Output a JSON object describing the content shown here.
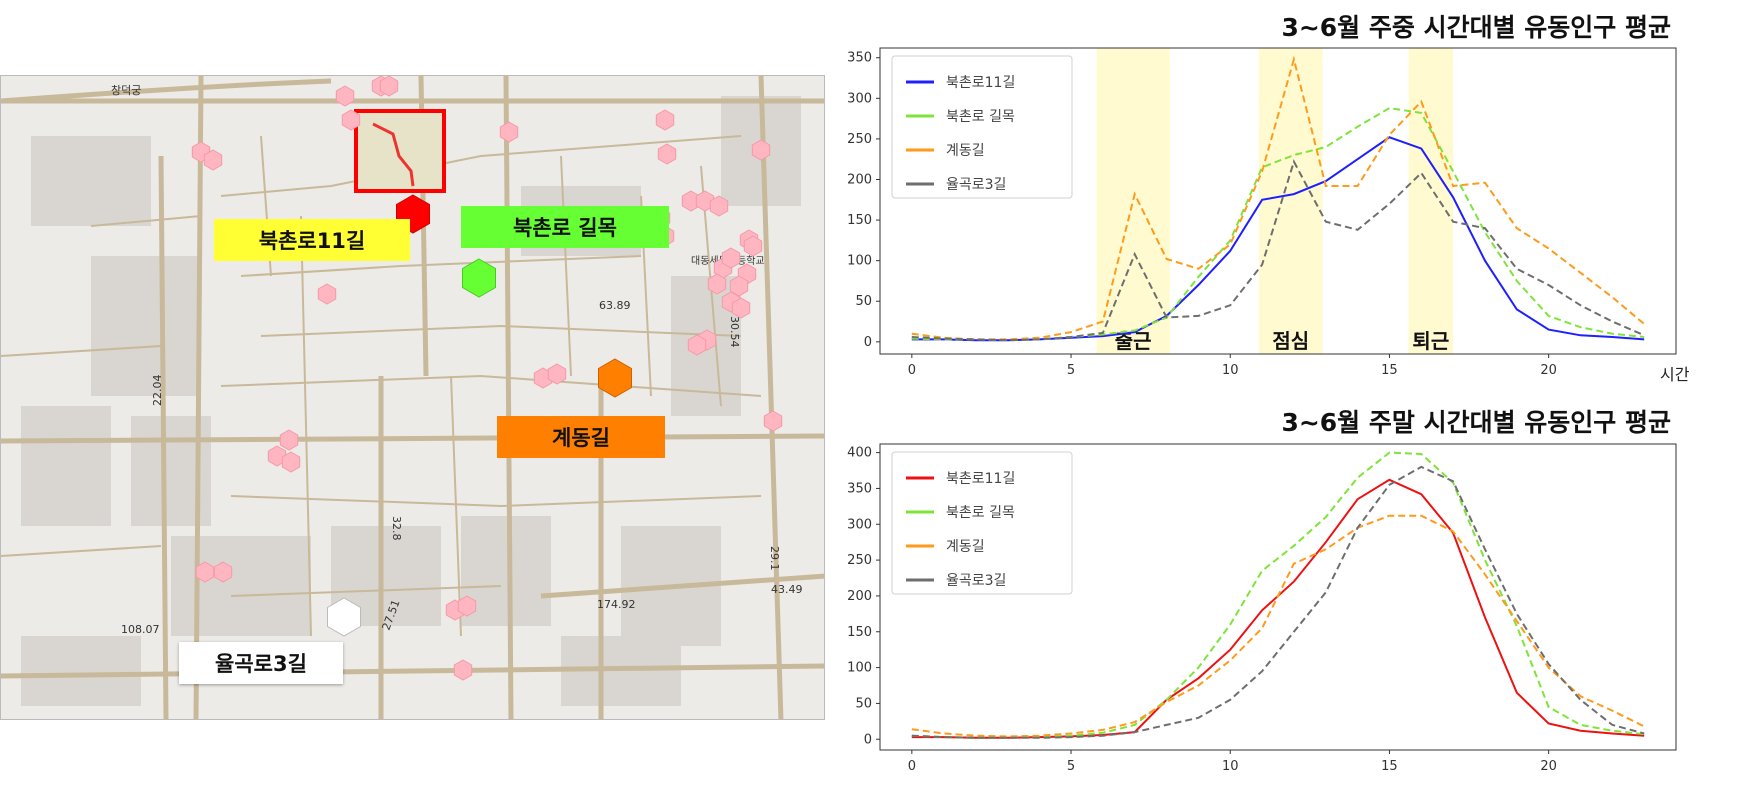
{
  "map": {
    "labels": {
      "bukchon11": "북촌로11길",
      "bukchon_alley": "북촌로 길목",
      "gyedong": "계동길",
      "yulgok3": "율곡로3길"
    },
    "colors": {
      "bukchon11": "#ffff33",
      "bukchon_alley": "#66ff33",
      "gyedong": "#ff8000",
      "yulgok3": "#ffffff",
      "bukchon11_marker": "#ff0000",
      "hex_other": "#ffb6c1",
      "highlight_box": "#ff0000"
    },
    "map_text": [
      "창덕궁",
      "대동세무고등학교",
      "63.89",
      "30.54",
      "32.8",
      "27.51",
      "22.04",
      "108.07",
      "174.92",
      "43.49",
      "29.1"
    ]
  },
  "charts": {
    "weekday": {
      "title": "3~6월 주중 시간대별 유동인구 평균",
      "x_unit": "시간",
      "bands": [
        {
          "label": "출근",
          "from": 5.8,
          "to": 8.1
        },
        {
          "label": "점심",
          "from": 10.9,
          "to": 12.9
        },
        {
          "label": "퇴근",
          "from": 15.6,
          "to": 17.0
        }
      ]
    },
    "weekend": {
      "title": "3~6월 주말 시간대별 유동인구 평균"
    }
  },
  "chart_data": [
    {
      "type": "line",
      "title": "3~6월 주중 시간대별 유동인구 평균",
      "xlabel": "시간",
      "ylabel": "",
      "xlim": [
        -1,
        24
      ],
      "ylim": [
        -15,
        362
      ],
      "x_ticks": [
        0,
        5,
        10,
        15,
        20
      ],
      "y_ticks": [
        0,
        50,
        100,
        150,
        200,
        250,
        300,
        350
      ],
      "legend": "top-left",
      "grid": false,
      "x": [
        0,
        1,
        2,
        3,
        4,
        5,
        6,
        7,
        8,
        9,
        10,
        11,
        12,
        13,
        14,
        15,
        16,
        17,
        18,
        19,
        20,
        21,
        22,
        23
      ],
      "series": [
        {
          "name": "북촌로11길",
          "color": "#1f1fff",
          "dash": "solid",
          "values": [
            3,
            3,
            2,
            2,
            3,
            5,
            7,
            12,
            32,
            70,
            112,
            175,
            182,
            198,
            225,
            252,
            238,
            178,
            100,
            40,
            15,
            8,
            6,
            3
          ]
        },
        {
          "name": "북촌로 길목",
          "color": "#7fe43a",
          "dash": "dashed",
          "values": [
            4,
            3,
            3,
            2,
            3,
            6,
            9,
            14,
            30,
            80,
            125,
            215,
            230,
            240,
            265,
            288,
            282,
            210,
            135,
            75,
            32,
            18,
            10,
            6
          ]
        },
        {
          "name": "계동길",
          "color": "#ff9a1a",
          "dash": "dashed",
          "values": [
            10,
            5,
            3,
            3,
            5,
            12,
            25,
            182,
            102,
            90,
            120,
            210,
            348,
            192,
            192,
            255,
            296,
            192,
            196,
            140,
            115,
            85,
            55,
            22
          ]
        },
        {
          "name": "율곡로3길",
          "color": "#6e6e6e",
          "dash": "dashed",
          "values": [
            6,
            4,
            3,
            2,
            3,
            6,
            11,
            108,
            30,
            32,
            45,
            95,
            222,
            148,
            138,
            170,
            208,
            148,
            140,
            90,
            70,
            45,
            25,
            8
          ]
        }
      ]
    },
    {
      "type": "line",
      "title": "3~6월 주말 시간대별 유동인구 평균",
      "xlabel": "",
      "ylabel": "",
      "xlim": [
        -1,
        24
      ],
      "ylim": [
        -15,
        412
      ],
      "x_ticks": [
        0,
        5,
        10,
        15,
        20
      ],
      "y_ticks": [
        0,
        50,
        100,
        150,
        200,
        250,
        300,
        350,
        400
      ],
      "legend": "top-left",
      "grid": false,
      "x": [
        0,
        1,
        2,
        3,
        4,
        5,
        6,
        7,
        8,
        9,
        10,
        11,
        12,
        13,
        14,
        15,
        16,
        17,
        18,
        19,
        20,
        21,
        22,
        23
      ],
      "series": [
        {
          "name": "북촌로11길",
          "color": "#ee1111",
          "dash": "solid",
          "values": [
            3,
            3,
            2,
            2,
            3,
            4,
            6,
            10,
            55,
            85,
            125,
            180,
            220,
            275,
            335,
            362,
            342,
            288,
            170,
            65,
            22,
            12,
            8,
            5
          ]
        },
        {
          "name": "북촌로 길목",
          "color": "#7fe43a",
          "dash": "dashed",
          "values": [
            5,
            3,
            2,
            2,
            3,
            5,
            9,
            20,
            55,
            100,
            160,
            235,
            270,
            310,
            365,
            400,
            398,
            358,
            250,
            158,
            45,
            20,
            12,
            7
          ]
        },
        {
          "name": "계동길",
          "color": "#ff9a1a",
          "dash": "dashed",
          "values": [
            14,
            8,
            5,
            4,
            5,
            8,
            13,
            24,
            52,
            75,
            110,
            155,
            245,
            265,
            295,
            312,
            312,
            290,
            230,
            165,
            100,
            60,
            40,
            18
          ]
        },
        {
          "name": "율곡로3길",
          "color": "#6e6e6e",
          "dash": "dashed",
          "values": [
            5,
            3,
            2,
            2,
            2,
            3,
            5,
            10,
            20,
            30,
            55,
            95,
            150,
            205,
            295,
            355,
            380,
            360,
            265,
            175,
            105,
            55,
            20,
            8
          ]
        }
      ]
    }
  ]
}
